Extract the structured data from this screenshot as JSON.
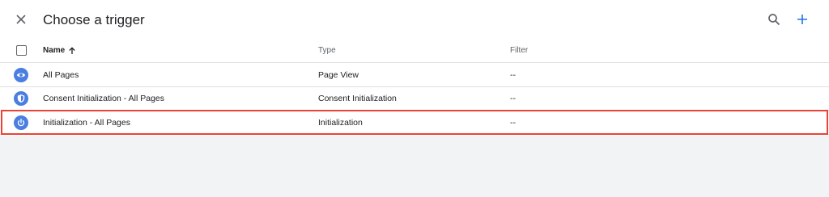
{
  "header": {
    "title": "Choose a trigger",
    "close_icon": "close-icon",
    "search_icon": "search-icon",
    "add_icon": "add-icon",
    "accent_color": "#1a73e8"
  },
  "table": {
    "columns": {
      "name": "Name",
      "type": "Type",
      "filter": "Filter"
    },
    "sort": "ascending",
    "rows": [
      {
        "icon": "eye-icon",
        "name": "All Pages",
        "type": "Page View",
        "filter": "--"
      },
      {
        "icon": "shield-icon",
        "name": "Consent Initialization - All Pages",
        "type": "Consent Initialization",
        "filter": "--"
      },
      {
        "icon": "power-icon",
        "name": "Initialization - All Pages",
        "type": "Initialization",
        "filter": "--",
        "highlighted": true
      }
    ]
  },
  "colors": {
    "trigger_icon_bg": "#4a7ee0",
    "highlight_border": "#ea4335"
  }
}
